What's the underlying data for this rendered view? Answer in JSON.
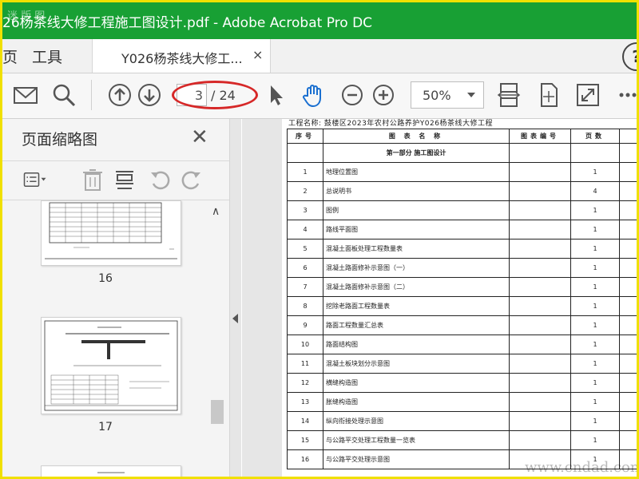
{
  "window": {
    "title": "26杨茶线大修工程施工图设计.pdf - Adobe Acrobat Pro DC",
    "watermark": "迷 版 图",
    "minimize_label": "—",
    "maximize_label": "□",
    "close_label": "✕",
    "accent_color": "#18a034"
  },
  "tabs": {
    "home_label": "页",
    "tools_label": "工具",
    "doc_tab_label": "Y026杨茶线大修工...",
    "doc_tab_close": "×",
    "help_label": "?"
  },
  "toolbar": {
    "page_current": "3",
    "page_total": "/ 24",
    "zoom_value": "50%"
  },
  "thumbnails_panel": {
    "title": "页面缩略图",
    "close_label": "✕",
    "thumbs": [
      {
        "label": "16"
      },
      {
        "label": "17"
      }
    ]
  },
  "document": {
    "header": "工程名称: 鼓楼区2023年农村公路养护Y026杨茶线大修工程",
    "columns": [
      "序号",
      "图 表 名 称",
      "图表编号",
      "页数"
    ],
    "section_title": "第一部分   施工图设计",
    "rows": [
      {
        "no": "1",
        "name": "地理位置图",
        "pages": "1"
      },
      {
        "no": "2",
        "name": "总说明书",
        "pages": "4"
      },
      {
        "no": "3",
        "name": "图例",
        "pages": "1"
      },
      {
        "no": "4",
        "name": "路线平面图",
        "pages": "1"
      },
      {
        "no": "5",
        "name": "混凝土面板处理工程数量表",
        "pages": "1"
      },
      {
        "no": "6",
        "name": "混凝土路面修补示意图（一）",
        "pages": "1"
      },
      {
        "no": "7",
        "name": "混凝土路面修补示意图（二）",
        "pages": "1"
      },
      {
        "no": "8",
        "name": "挖除老路面工程数量表",
        "pages": "1"
      },
      {
        "no": "9",
        "name": "路面工程数量汇总表",
        "pages": "1"
      },
      {
        "no": "10",
        "name": "路面结构图",
        "pages": "1"
      },
      {
        "no": "11",
        "name": "混凝土板块划分示意图",
        "pages": "1"
      },
      {
        "no": "12",
        "name": "横缝构造图",
        "pages": "1"
      },
      {
        "no": "13",
        "name": "胀缝构造图",
        "pages": "1"
      },
      {
        "no": "14",
        "name": "纵向衔接处理示意图",
        "pages": "1"
      },
      {
        "no": "15",
        "name": "与公路平交处理工程数量一览表",
        "pages": "1"
      },
      {
        "no": "16",
        "name": "与公路平交处理示意图",
        "pages": "1"
      }
    ],
    "site_watermark": "www.cndad.com"
  }
}
